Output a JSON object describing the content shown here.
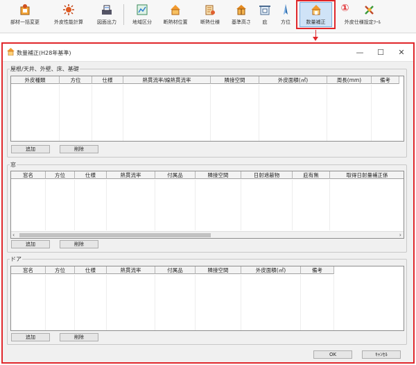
{
  "toolbar": {
    "buttons": [
      {
        "label": "部材一括変更",
        "icon": "building-gear-icon"
      },
      {
        "label": "外皮性能計算",
        "icon": "calculator-burst-icon"
      },
      {
        "label": "図面出力",
        "icon": "print-drawing-icon"
      },
      {
        "label": "地域区分",
        "icon": "region-map-icon"
      },
      {
        "label": "断熱材位置",
        "icon": "insulation-position-icon"
      },
      {
        "label": "断熱仕様",
        "icon": "insulation-spec-icon"
      },
      {
        "label": "基準高さ",
        "icon": "reference-height-icon"
      },
      {
        "label": "庇",
        "icon": "eave-icon"
      },
      {
        "label": "方位",
        "icon": "compass-icon"
      },
      {
        "label": "数量補正",
        "icon": "quantity-correction-icon"
      },
      {
        "label": "外皮仕様設定ﾂｰﾙ",
        "icon": "envelope-spec-tool-icon"
      }
    ],
    "step_marker": "①"
  },
  "dialog": {
    "title": "数量補正(H28年基準)",
    "minimize": "—",
    "maximize": "☐",
    "close": "✕",
    "sections": [
      {
        "label": "屋根/天井、外壁、床、基礎",
        "columns": [
          "外皮種類",
          "方位",
          "仕様",
          "熱貫流率/線熱貫流率",
          "隣接空間",
          "外皮面積(㎡)",
          "周長(mm)",
          "備考"
        ],
        "add": "追加",
        "delete": "削除"
      },
      {
        "label": "窓",
        "columns": [
          "窓名",
          "方位",
          "仕様",
          "熱貫流率",
          "付属品",
          "隣接空間",
          "日射遮蔽物",
          "庇有無",
          "取得日射量補正係"
        ],
        "add": "追加",
        "delete": "削除",
        "scroll_left": "‹",
        "scroll_right": "›"
      },
      {
        "label": "ドア",
        "columns": [
          "窓名",
          "方位",
          "仕様",
          "熱貫流率",
          "付属品",
          "隣接空間",
          "外皮面積(㎡)",
          "備考"
        ],
        "add": "追加",
        "delete": "削除"
      }
    ],
    "ok": "OK",
    "cancel": "ｷｬﾝｾﾙ"
  },
  "colors": {
    "highlight": "#e0262a",
    "selected_button": "#cfe3f7"
  }
}
